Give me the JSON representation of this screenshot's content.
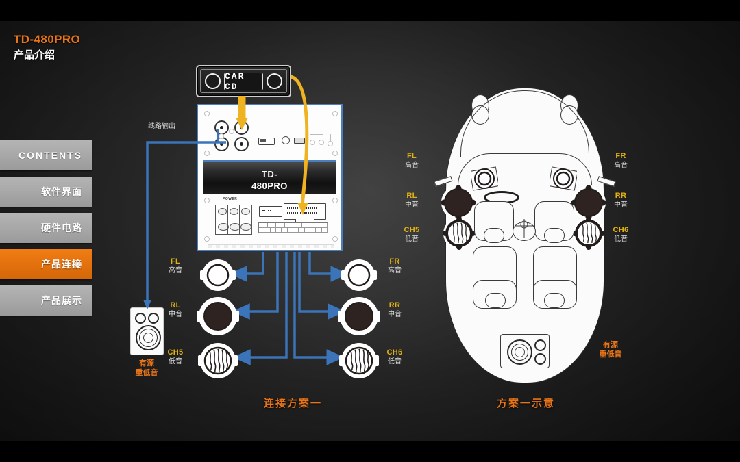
{
  "header": {
    "title": "TD-480PRO",
    "subtitle": "产品介绍",
    "title_color": "#e8751a"
  },
  "sidebar": {
    "items": [
      {
        "label": "CONTENTS",
        "active": false
      },
      {
        "label": "软件界面",
        "active": false
      },
      {
        "label": "硬件电路",
        "active": false
      },
      {
        "label": "产品连接",
        "active": true
      },
      {
        "label": "产品展示",
        "active": false
      }
    ],
    "active_color": "#e8751a",
    "inactive_color": "#a8a8a8"
  },
  "diagram": {
    "head_unit_label": "CAR CD",
    "line_out_label": "线路输出",
    "amp_label_line1": "TD-",
    "amp_label_line2": "480PRO",
    "amp_power_label": "POWER",
    "wire_colors": {
      "signal": "#3b74b8",
      "speaker_bus": "#4a7fbf",
      "power": "#efb322"
    }
  },
  "speakers_left": [
    {
      "ch": "FL",
      "cn": "高音"
    },
    {
      "ch": "RL",
      "cn": "中音"
    },
    {
      "ch": "CH5",
      "cn": "低音"
    }
  ],
  "speakers_right": [
    {
      "ch": "FR",
      "cn": "高音"
    },
    {
      "ch": "RR",
      "cn": "中音"
    },
    {
      "ch": "CH6",
      "cn": "低音"
    }
  ],
  "subwoofer": {
    "line1": "有源",
    "line2": "重低音"
  },
  "car_labels_left": [
    {
      "ch": "FL",
      "cn": "高音"
    },
    {
      "ch": "RL",
      "cn": "中音"
    },
    {
      "ch": "CH5",
      "cn": "低音"
    }
  ],
  "car_labels_right": [
    {
      "ch": "FR",
      "cn": "高音"
    },
    {
      "ch": "RR",
      "cn": "中音"
    },
    {
      "ch": "CH6",
      "cn": "低音"
    }
  ],
  "car_sub": {
    "line1": "有源",
    "line2": "重低音"
  },
  "captions": {
    "left": "连接方案一",
    "right": "方案一示意"
  }
}
